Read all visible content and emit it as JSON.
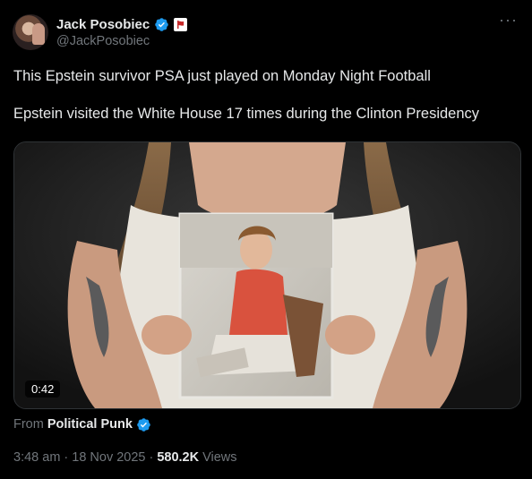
{
  "author": {
    "name": "Jack Posobiec",
    "handle": "@JackPosobiec",
    "verified": true,
    "affiliate_badge": "flag-icon"
  },
  "more_label": "···",
  "tweet": {
    "lines": [
      "This Epstein survivor PSA just played on Monday Night Football",
      "Epstein visited the White House 17 times during the Clinton Presidency"
    ]
  },
  "video": {
    "duration": "0:42"
  },
  "source": {
    "prefix": "From",
    "name": "Political Punk",
    "verified": true
  },
  "meta": {
    "time": "3:48 am",
    "sep1": "·",
    "date": "18 Nov 2025",
    "sep2": "·",
    "views": "580.2K",
    "views_label": "Views"
  },
  "colors": {
    "background": "#000000",
    "text": "#e7e9ea",
    "secondary": "#71767b",
    "verified_blue": "#1d9bf0",
    "border": "#2f3336"
  }
}
